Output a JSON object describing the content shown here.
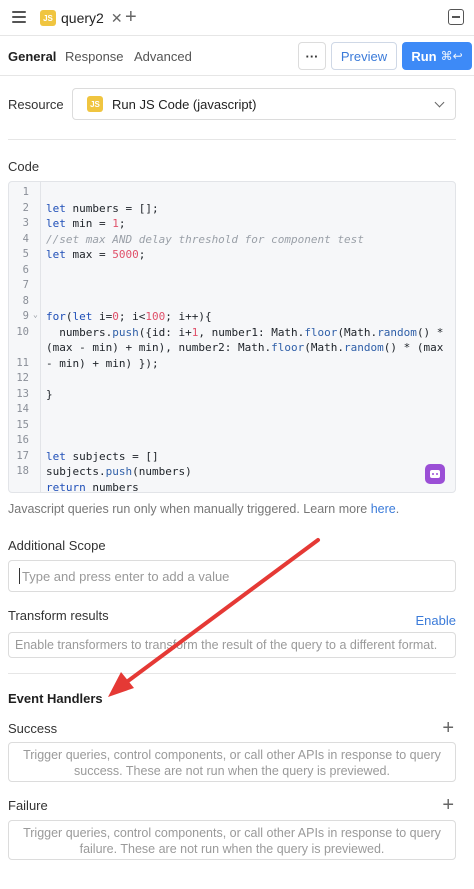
{
  "topbar": {
    "query_tab_badge": "JS",
    "query_tab_name": "query2",
    "close_glyph": "✕",
    "add_tab_glyph": "+"
  },
  "subtabs": {
    "items": [
      "General",
      "Response",
      "Advanced"
    ],
    "active": "General",
    "more_label": "···",
    "preview_label": "Preview",
    "run_label": "Run",
    "run_shortcut": "⌘↩"
  },
  "resource": {
    "label": "Resource",
    "badge": "JS",
    "value": "Run JS Code (javascript)"
  },
  "code": {
    "label": "Code",
    "line_numbers": [
      "1",
      "2",
      "3",
      "4",
      "5",
      "6",
      "7",
      "8",
      "9",
      "10",
      "",
      "11",
      "12",
      "13",
      "14",
      "15",
      "16",
      "17",
      "18"
    ],
    "lines": [
      "",
      "let numbers = [];",
      "let min = 1;",
      "//set max AND delay threshold for component test",
      "let max = 5000;",
      "",
      "",
      "",
      "for(let i=0; i<100; i++){",
      "  numbers.push({id: i+1, number1: Math.floor(Math.random() *",
      "(max - min) + min), number2: Math.floor(Math.random() * (max",
      "- min) + min) });",
      "",
      "}",
      "",
      "",
      "",
      "let subjects = []",
      "subjects.push(numbers)",
      "return numbers"
    ]
  },
  "help": {
    "text": "Javascript queries run only when manually triggered. Learn more ",
    "link": "here",
    "suffix": "."
  },
  "additional_scope": {
    "label": "Additional Scope",
    "placeholder": "Type and press enter to add a value"
  },
  "transform": {
    "label": "Transform results",
    "enable_label": "Enable",
    "placeholder": "Enable transformers to transform the result of the query to a different format."
  },
  "event_handlers": {
    "title": "Event Handlers",
    "success": {
      "label": "Success",
      "text": "Trigger queries, control components, or call other APIs in response to query success. These are not run when the query is previewed."
    },
    "failure": {
      "label": "Failure",
      "text": "Trigger queries, control components, or call other APIs in response to query failure. These are not run when the query is previewed."
    },
    "add_glyph": "+"
  },
  "colors": {
    "accent": "#3d8af7",
    "link": "#3b7bd9",
    "js_badge": "#f0c540",
    "annotation_arrow": "#e53935",
    "ai_button": "#9b4fd6"
  }
}
